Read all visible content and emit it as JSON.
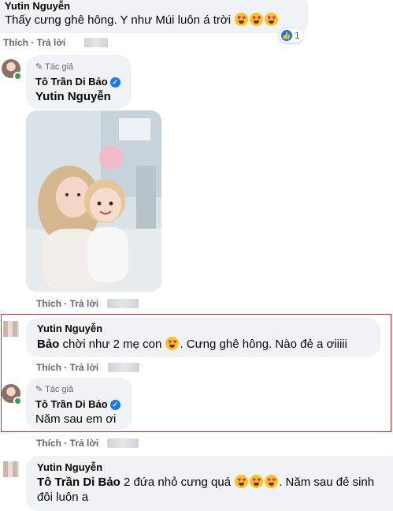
{
  "comments": [
    {
      "id": "c1",
      "author": "Yutin Nguyễn",
      "text": "Thấy cưng ghê hông. Y như Múi luôn á trời",
      "emoji_count": 3,
      "actions": {
        "like": "Thích",
        "reply": "Trả lời"
      },
      "reaction_count": "1"
    },
    {
      "id": "c2",
      "badge": "Tác giả",
      "author": "Tô Trần Di Bảo",
      "mention": "Yutin Nguyễn",
      "has_photo": true,
      "actions": {
        "like": "Thích",
        "reply": "Trả lời"
      }
    },
    {
      "id": "c3",
      "author": "Yutin Nguyễn",
      "mention": "Bảo",
      "text_before_emoji": "chời như 2 mẹ con",
      "text_after_emoji": ". Cưng ghê hông. Nào đẻ a ơiiiii",
      "actions": {
        "like": "Thích",
        "reply": "Trả lời"
      }
    },
    {
      "id": "c4",
      "badge": "Tác giả",
      "author": "Tô Trần Di Bảo",
      "text": "Năm sau em ơi",
      "actions": {
        "like": "Thích",
        "reply": "Trả lời"
      }
    },
    {
      "id": "c5",
      "author": "Yutin Nguyễn",
      "mention": "Tô Trần Di Bảo",
      "text_line1": "2 đứa nhỏ cưng quá",
      "text_line1_after": ". Năm sau đẻ sinh",
      "text_line2": "đôi luôn a"
    }
  ],
  "colors": {
    "bubble": "#f0f2f5",
    "highlight_border": "#c6252c",
    "verified": "#1877f2",
    "online": "#31a24c",
    "action_text": "#65676b"
  },
  "icons": [
    "verified-badge-icon",
    "heart-eyes-emoji-icon",
    "like-reaction-icon",
    "pen-author-icon"
  ]
}
